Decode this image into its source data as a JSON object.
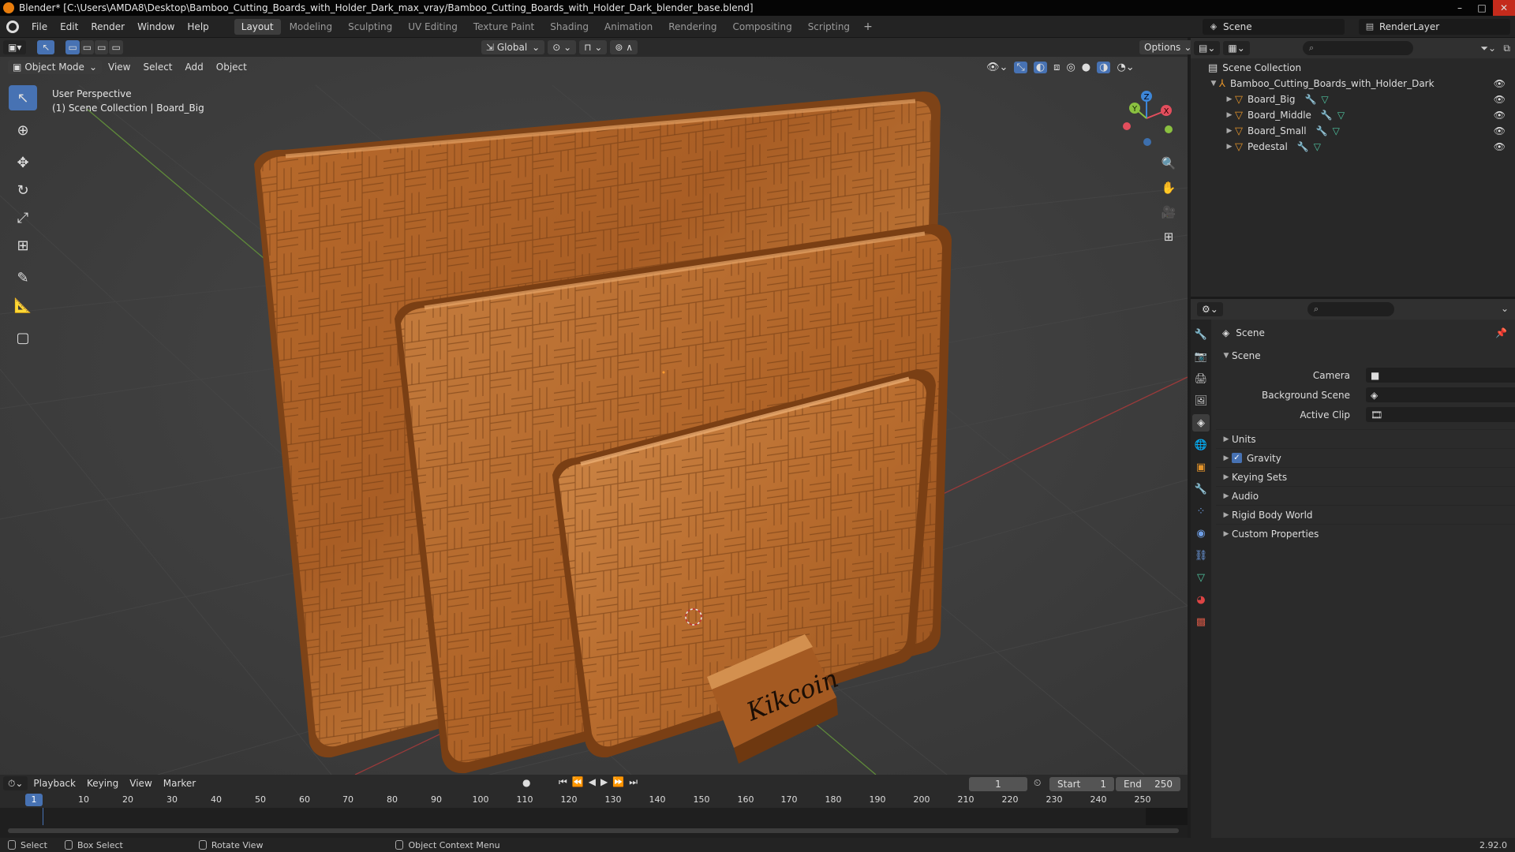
{
  "window": {
    "title": "Blender* [C:\\Users\\AMDA8\\Desktop\\Bamboo_Cutting_Boards_with_Holder_Dark_max_vray/Bamboo_Cutting_Boards_with_Holder_Dark_blender_base.blend]",
    "minimize": "–",
    "maximize": "□",
    "close": "✕"
  },
  "menu": [
    "File",
    "Edit",
    "Render",
    "Window",
    "Help"
  ],
  "workspaces": [
    "Layout",
    "Modeling",
    "Sculpting",
    "UV Editing",
    "Texture Paint",
    "Shading",
    "Animation",
    "Rendering",
    "Compositing",
    "Scripting"
  ],
  "active_workspace": "Layout",
  "add_workspace": "+",
  "scene_selector": "Scene",
  "render_layer": "RenderLayer",
  "viewport": {
    "transform_orientation": "Global",
    "options_label": "Options",
    "mode": "Object Mode",
    "header_menus": [
      "View",
      "Select",
      "Add",
      "Object"
    ],
    "overlay_line1": "User Perspective",
    "overlay_line2": "(1) Scene Collection | Board_Big",
    "logo_text": "Kikcoin",
    "gizmo_axes": {
      "x": "X",
      "y": "Y",
      "z": "Z"
    }
  },
  "outliner": {
    "root": "Scene Collection",
    "collection": "Bamboo_Cutting_Boards_with_Holder_Dark",
    "objects": [
      "Board_Big",
      "Board_Middle",
      "Board_Small",
      "Pedestal"
    ]
  },
  "properties": {
    "breadcrumb": "Scene",
    "section": "Scene",
    "fields": {
      "camera_label": "Camera",
      "background_scene_label": "Background Scene",
      "active_clip_label": "Active Clip"
    },
    "subpanels": [
      "Units",
      "Gravity",
      "Keying Sets",
      "Audio",
      "Rigid Body World",
      "Custom Properties"
    ],
    "gravity_checked": true
  },
  "timeline": {
    "menus": [
      "Playback",
      "Keying",
      "View",
      "Marker"
    ],
    "current_frame": "1",
    "start_label": "Start",
    "start_value": "1",
    "end_label": "End",
    "end_value": "250",
    "ruler": [
      "10",
      "20",
      "30",
      "40",
      "50",
      "60",
      "70",
      "80",
      "90",
      "100",
      "110",
      "120",
      "130",
      "140",
      "150",
      "160",
      "170",
      "180",
      "190",
      "200",
      "210",
      "220",
      "230",
      "240",
      "250"
    ],
    "ruler_current": "1"
  },
  "statusbar": {
    "select": "Select",
    "box_select": "Box Select",
    "rotate_view": "Rotate View",
    "context_menu": "Object Context Menu",
    "version": "2.92.0"
  }
}
